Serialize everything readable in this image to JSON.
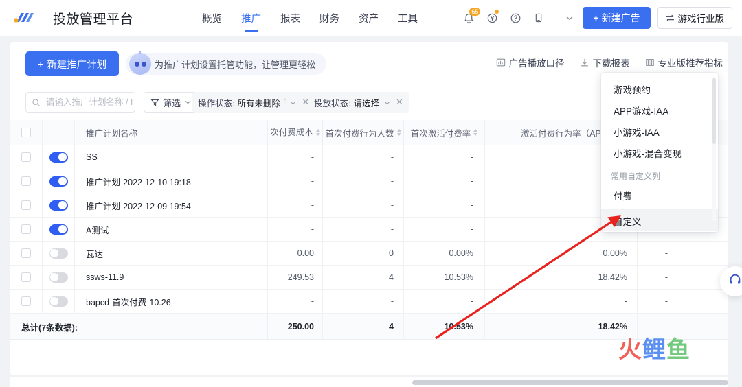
{
  "header": {
    "logo_icon": "brand-logo-icon",
    "app_title": "投放管理平台",
    "nav": [
      {
        "label": "概览",
        "active": false
      },
      {
        "label": "推广",
        "active": true
      },
      {
        "label": "报表",
        "active": false
      },
      {
        "label": "财务",
        "active": false
      },
      {
        "label": "资产",
        "active": false
      },
      {
        "label": "工具",
        "active": false
      }
    ],
    "icons": {
      "bell": "bell-icon",
      "bell_badge": "65",
      "wallet": "wallet-yuan-icon",
      "help": "help-circle-icon",
      "mobile": "mobile-icon",
      "caret": "chevron-down-icon"
    },
    "new_ad_button": "新建广告",
    "new_ad_plus": "+",
    "industry_button": "游戏行业版",
    "industry_icon": "switch-arrows-icon"
  },
  "toolbar": {
    "new_plan_button": "新建推广计划",
    "new_plan_plus": "+",
    "hosting_tip": "为推广计划设置托管功能，让管理更轻松",
    "hosting_icon": "robot-icon",
    "actions": [
      {
        "label": "广告播放口径",
        "icon": "chart-caliber-icon"
      },
      {
        "label": "下载报表",
        "icon": "download-icon"
      },
      {
        "label": "专业版推荐指标",
        "icon": "columns-icon"
      }
    ]
  },
  "filters": {
    "search_placeholder": "请输入推广计划名称 / ID",
    "search_value": "",
    "search_icon": "search-icon",
    "filter_button": "筛选",
    "filter_icon": "funnel-icon",
    "chips": [
      {
        "label": "操作状态:",
        "value": "所有未删除",
        "count": "1",
        "has_count": true
      },
      {
        "label": "投放状态:",
        "value": "请选择",
        "count": "",
        "has_count": false
      }
    ]
  },
  "table": {
    "columns": [
      {
        "key": "checkbox",
        "label": "",
        "sortable": false
      },
      {
        "key": "toggle",
        "label": "",
        "sortable": false
      },
      {
        "key": "name",
        "label": "推广计划名称",
        "sortable": false
      },
      {
        "key": "second_pay_cost",
        "label": "次付费成本",
        "sortable": true
      },
      {
        "key": "first_pay_users",
        "label": "首次付费行为人数",
        "sortable": true
      },
      {
        "key": "first_activate_pay_rate",
        "label": "首次激活付费率",
        "sortable": true
      },
      {
        "key": "activate_pay_rate",
        "label": "激活付费行为率（AP",
        "sortable": false
      }
    ],
    "rows": [
      {
        "checked": false,
        "enabled": true,
        "name": "SS",
        "second_pay_cost": "-",
        "first_pay_users": "-",
        "first_activate_pay_rate": "-",
        "activate_pay_rate": "-",
        "extra": ""
      },
      {
        "checked": false,
        "enabled": true,
        "name": "推广计划-2022-12-10 19:18",
        "second_pay_cost": "-",
        "first_pay_users": "-",
        "first_activate_pay_rate": "-",
        "activate_pay_rate": "-",
        "extra": ""
      },
      {
        "checked": false,
        "enabled": true,
        "name": "推广计划-2022-12-09 19:54",
        "second_pay_cost": "-",
        "first_pay_users": "-",
        "first_activate_pay_rate": "-",
        "activate_pay_rate": "-",
        "extra": ""
      },
      {
        "checked": false,
        "enabled": true,
        "name": "A测试",
        "second_pay_cost": "-",
        "first_pay_users": "-",
        "first_activate_pay_rate": "-",
        "activate_pay_rate": "-",
        "extra": "-"
      },
      {
        "checked": false,
        "enabled": false,
        "name": "瓦达",
        "second_pay_cost": "0.00",
        "first_pay_users": "0",
        "first_activate_pay_rate": "0.00%",
        "activate_pay_rate": "0.00%",
        "extra": "-"
      },
      {
        "checked": false,
        "enabled": false,
        "name": "ssws-11.9",
        "second_pay_cost": "249.53",
        "first_pay_users": "4",
        "first_activate_pay_rate": "10.53%",
        "activate_pay_rate": "18.42%",
        "extra": "-"
      },
      {
        "checked": false,
        "enabled": false,
        "name": "bapcd-首次付费-10.26",
        "second_pay_cost": "-",
        "first_pay_users": "-",
        "first_activate_pay_rate": "-",
        "activate_pay_rate": "-",
        "extra": "-"
      }
    ],
    "total": {
      "label": "总计(7条数据):",
      "second_pay_cost": "250.00",
      "first_pay_users": "4",
      "first_activate_pay_rate": "10.53%",
      "activate_pay_rate": "18.42%"
    }
  },
  "dropdown": {
    "items": [
      {
        "label": "游戏预约",
        "highlighted": false
      },
      {
        "label": "APP游戏-IAA",
        "highlighted": false
      },
      {
        "label": "小游戏-IAA",
        "highlighted": false
      },
      {
        "label": "小游戏-混合变现",
        "highlighted": false
      }
    ],
    "group_label": "常用自定义列",
    "group_items": [
      {
        "label": "付费",
        "highlighted": false
      }
    ],
    "footer_item": {
      "label": "自定义",
      "highlighted": true
    }
  },
  "annotation": {
    "arrow_color": "#e8221d",
    "arrow_from": "635,492",
    "arrow_to": "905,313"
  },
  "watermark": {
    "part1": "火",
    "part2": "鲤",
    "part3": "鱼",
    "color1": "#f0615a",
    "color2": "#5b8ff0",
    "color3": "#73c97d"
  },
  "float_button": {
    "icon": "headset-support-icon"
  },
  "colors": {
    "accent": "#3a6ff0",
    "toggle_on": "#2f5ef0",
    "page_bg": "#f0f2f5",
    "badge": "#f5a623"
  }
}
